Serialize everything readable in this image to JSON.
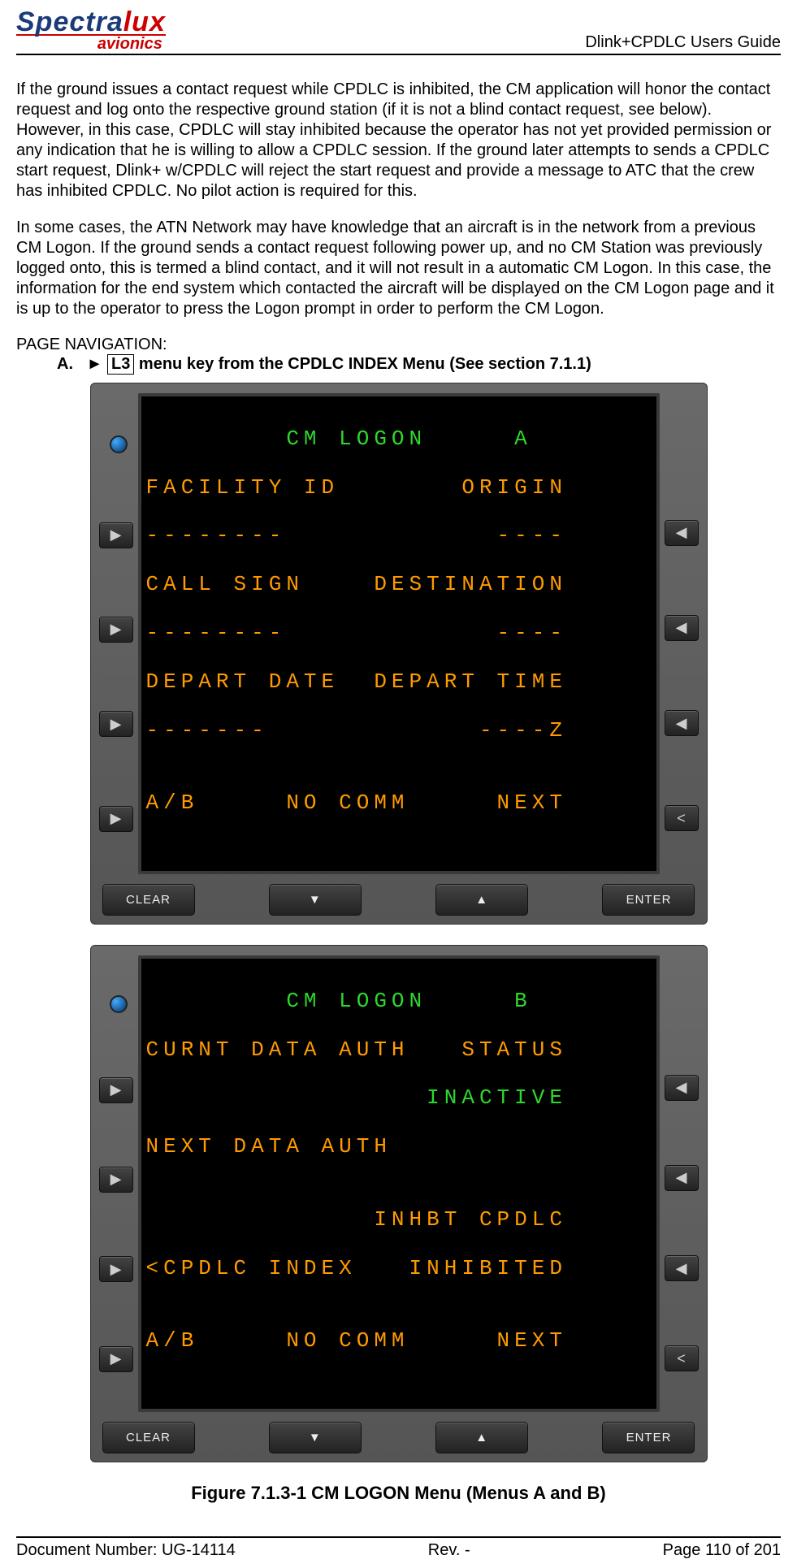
{
  "header": {
    "logo_main_a": "Spectra",
    "logo_main_b": "lux",
    "logo_sub": "avionics",
    "doc_title": "Dlink+CPDLC Users Guide"
  },
  "paragraphs": {
    "p1": "If the ground issues a contact request while CPDLC is inhibited, the CM application will honor the contact request and log onto the respective ground station (if it is not a blind contact request, see below). However, in this case, CPDLC will stay inhibited because the operator has not yet provided permission or any indication that he is willing to allow a CPDLC session. If the ground later attempts to sends a CPDLC start request, Dlink+ w/CPDLC will reject the start request and provide a message to ATC that the crew has inhibited CPDLC. No pilot action is required for this.",
    "p2": "In some cases, the ATN Network may have knowledge that an aircraft is in the network from a previous CM Logon. If the ground sends a contact request following power up, and no CM Station was previously logged onto, this is termed a blind contact, and it will not result in a automatic CM Logon. In this case, the information for the end system which contacted the aircraft will be displayed on the CM Logon page and it is up to the operator to press the Logon prompt in order to perform the CM Logon."
  },
  "nav": {
    "label": "PAGE NAVIGATION:",
    "item_prefix": "A.",
    "arrow": "►",
    "key": "L3",
    "item_text": " menu key from the CPDLC INDEX Menu (See section 7.1.1)"
  },
  "screens": {
    "a": {
      "title": "        CM LOGON     A",
      "l1": "FACILITY ID       ORIGIN",
      "l2": "--------            ----",
      "l3": "CALL SIGN    DESTINATION",
      "l4": "--------            ----",
      "l5": "DEPART DATE  DEPART TIME",
      "l6": "-------            ----Z",
      "l7": "",
      "l8": "A/B     NO COMM     NEXT"
    },
    "b": {
      "title": "        CM LOGON     B",
      "l1": "CURNT DATA AUTH   STATUS",
      "l2": "                INACTIVE",
      "l3": "NEXT DATA AUTH",
      "l4": "",
      "l5": "             INHBT CPDLC",
      "l6": "<CPDLC INDEX   INHIBITED",
      "l7": "",
      "l8": "A/B     NO COMM     NEXT"
    }
  },
  "buttons": {
    "clear": "CLEAR",
    "enter": "ENTER",
    "up": "▲",
    "down": "▼",
    "left": "◀",
    "right": "▶",
    "back": "<"
  },
  "caption": "Figure 7.1.3-1 CM LOGON Menu (Menus A and B)",
  "footer": {
    "doc_num": "Document Number:  UG-14114",
    "rev": "Rev. -",
    "page": "Page 110 of 201"
  }
}
